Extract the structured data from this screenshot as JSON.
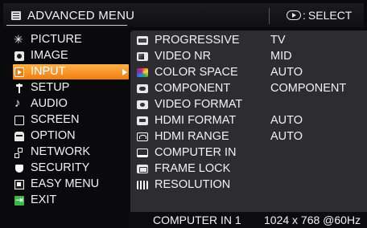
{
  "header": {
    "title": "ADVANCED MENU",
    "title_icon": "menu-icon",
    "hint_icon": "enter-icon",
    "hint_colon": ":",
    "hint_label": "SELECT"
  },
  "left_menu": {
    "selected_index": 2,
    "items": [
      {
        "label": "PICTURE",
        "icon": "picture-icon"
      },
      {
        "label": "IMAGE",
        "icon": "image-icon"
      },
      {
        "label": "INPUT",
        "icon": "input-icon"
      },
      {
        "label": "SETUP",
        "icon": "setup-icon"
      },
      {
        "label": "AUDIO",
        "icon": "audio-icon"
      },
      {
        "label": "SCREEN",
        "icon": "screen-icon"
      },
      {
        "label": "OPTION",
        "icon": "option-icon"
      },
      {
        "label": "NETWORK",
        "icon": "network-icon"
      },
      {
        "label": "SECURITY",
        "icon": "security-icon"
      },
      {
        "label": "EASY MENU",
        "icon": "easy-menu-icon"
      },
      {
        "label": "EXIT",
        "icon": "exit-icon"
      }
    ],
    "selected_color": "#f59a2a"
  },
  "input_panel": {
    "rows": [
      {
        "label": "PROGRESSIVE",
        "value": "TV",
        "icon": "progressive-icon"
      },
      {
        "label": "VIDEO NR",
        "value": "MID",
        "icon": "video-nr-icon"
      },
      {
        "label": "COLOR SPACE",
        "value": "AUTO",
        "icon": "color-space-icon"
      },
      {
        "label": "COMPONENT",
        "value": "COMPONENT",
        "icon": "component-icon"
      },
      {
        "label": "VIDEO FORMAT",
        "value": "",
        "icon": "video-format-icon"
      },
      {
        "label": "HDMI FORMAT",
        "value": "AUTO",
        "icon": "hdmi-format-icon"
      },
      {
        "label": "HDMI RANGE",
        "value": "AUTO",
        "icon": "hdmi-range-icon"
      },
      {
        "label": "COMPUTER IN",
        "value": "",
        "icon": "computer-in-icon"
      },
      {
        "label": "FRAME LOCK",
        "value": "",
        "icon": "frame-lock-icon"
      },
      {
        "label": "RESOLUTION",
        "value": "",
        "icon": "resolution-icon"
      }
    ],
    "background_color": "#2d2c31"
  },
  "footer": {
    "source": "COMPUTER IN 1",
    "signal": "1024 x 768 @60Hz"
  }
}
